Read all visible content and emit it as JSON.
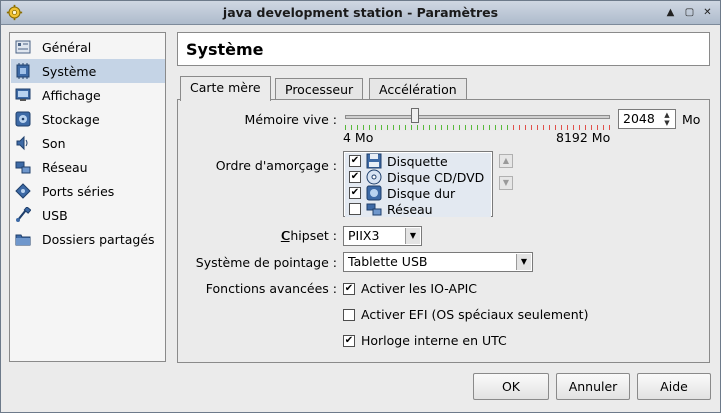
{
  "window": {
    "title": "java development station - Paramètres"
  },
  "sidebar": {
    "items": [
      {
        "label": "Général",
        "icon": "general-icon"
      },
      {
        "label": "Système",
        "icon": "system-icon",
        "selected": true
      },
      {
        "label": "Affichage",
        "icon": "display-icon"
      },
      {
        "label": "Stockage",
        "icon": "storage-icon"
      },
      {
        "label": "Son",
        "icon": "audio-icon"
      },
      {
        "label": "Réseau",
        "icon": "network-icon"
      },
      {
        "label": "Ports séries",
        "icon": "serial-ports-icon"
      },
      {
        "label": "USB",
        "icon": "usb-icon"
      },
      {
        "label": "Dossiers partagés",
        "icon": "shared-folders-icon"
      }
    ]
  },
  "section": {
    "title": "Système"
  },
  "tabs": [
    {
      "label": "Carte mère",
      "active": true
    },
    {
      "label": "Processeur"
    },
    {
      "label": "Accélération"
    }
  ],
  "memory": {
    "label": "Mémoire vive :",
    "value": "2048",
    "unit": "Mo",
    "min_label": "4 Mo",
    "max_label": "8192 Mo",
    "slider_fraction": 0.25
  },
  "boot_order": {
    "label": "Ordre d'amorçage :",
    "items": [
      {
        "label": "Disquette",
        "checked": true,
        "icon": "floppy-icon"
      },
      {
        "label": "Disque CD/DVD",
        "checked": true,
        "icon": "cd-dvd-icon"
      },
      {
        "label": "Disque dur",
        "checked": true,
        "icon": "hard-disk-icon"
      },
      {
        "label": "Réseau",
        "checked": false,
        "icon": "network-boot-icon"
      }
    ]
  },
  "chipset": {
    "label": "Chipset :",
    "value": "PIIX3"
  },
  "pointing": {
    "label": "Système de pointage :",
    "value": "Tablette USB"
  },
  "advanced": {
    "label": "Fonctions avancées :",
    "options": [
      {
        "label": "Activer les IO-APIC",
        "checked": true
      },
      {
        "label": "Activer EFI (OS spéciaux seulement)",
        "checked": false
      },
      {
        "label": "Horloge interne en UTC",
        "checked": true
      }
    ]
  },
  "buttons": {
    "ok": "OK",
    "cancel": "Annuler",
    "help": "Aide"
  },
  "colors": {
    "selected_bg": "#c5d4e6",
    "slider_green": "#57b83a",
    "slider_red": "#e0504a"
  }
}
